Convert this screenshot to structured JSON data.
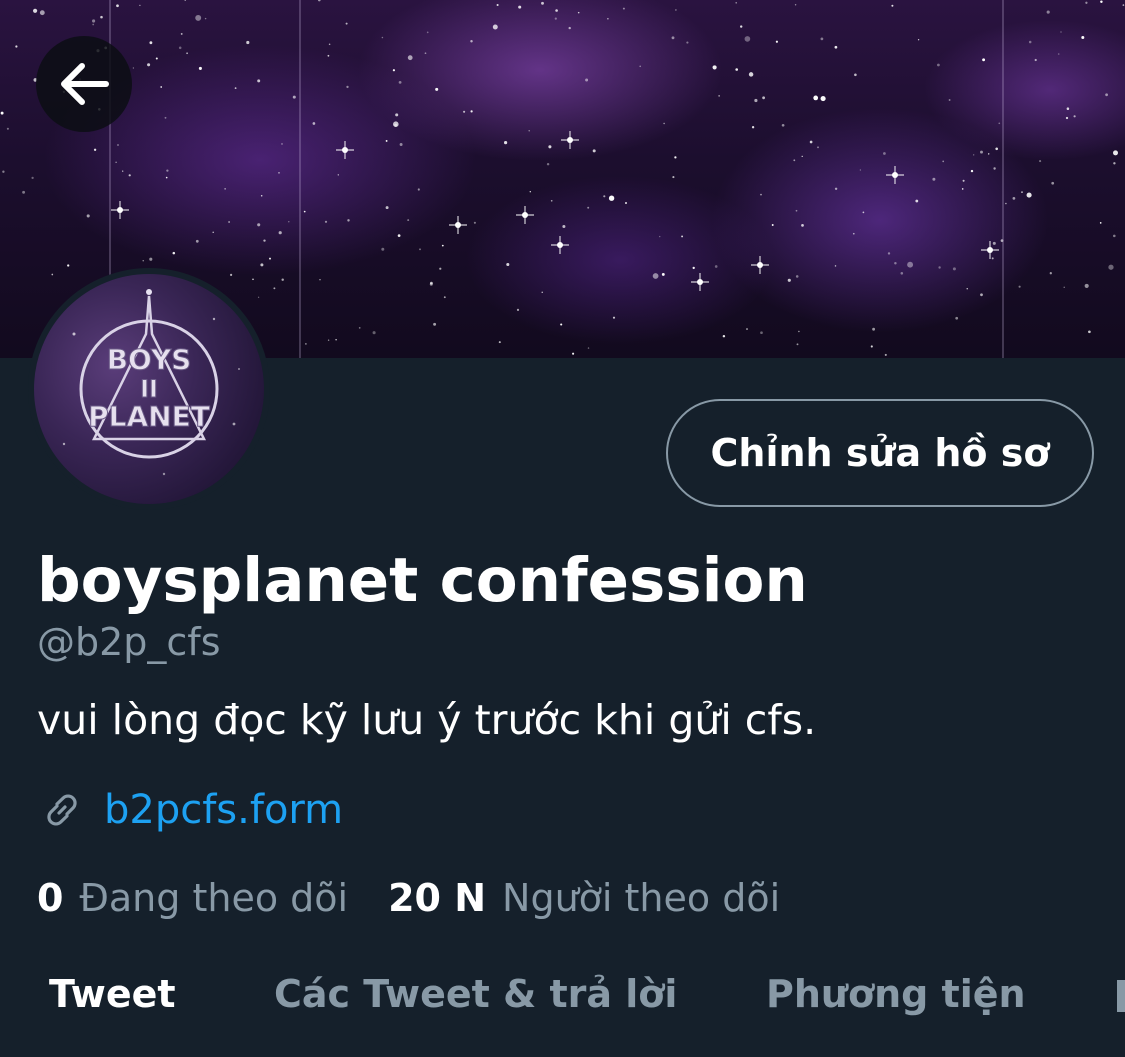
{
  "header": {
    "back_icon": "arrow-left-icon"
  },
  "avatar": {
    "logo_line1": "BOYS",
    "logo_line2": "II",
    "logo_line3": "PLANET"
  },
  "profile": {
    "edit_button_label": "Chỉnh sửa hồ sơ",
    "display_name": "boysplanet confession",
    "handle": "@b2p_cfs",
    "bio": "vui lòng đọc kỹ lưu ý trước khi gửi cfs.",
    "link_icon": "link-icon",
    "link_text": "b2pcfs.form"
  },
  "stats": {
    "following_count": "0",
    "following_label": "Đang theo dõi",
    "followers_count": "20 N",
    "followers_label": "Người theo dõi"
  },
  "tabs": [
    {
      "label": "Tweet",
      "active": true
    },
    {
      "label": "Các Tweet & trả lời",
      "active": false
    },
    {
      "label": "Phương tiện",
      "active": false
    }
  ],
  "colors": {
    "background": "#15202b",
    "secondary_text": "#8899a6",
    "link": "#1da1f2",
    "banner_purple": "#6a35a8"
  }
}
